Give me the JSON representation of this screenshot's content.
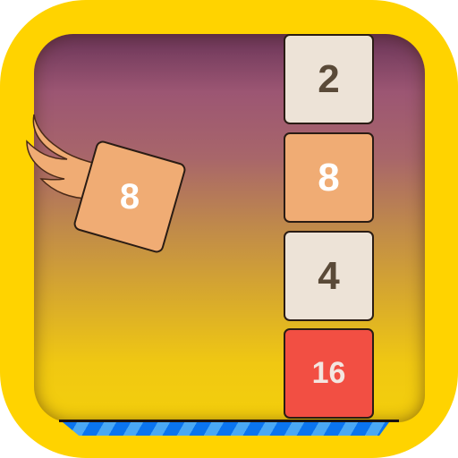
{
  "flying_tile": {
    "value": "8",
    "color": "#f0ac74"
  },
  "stack": [
    {
      "value": "2",
      "color": "#ede3d7"
    },
    {
      "value": "8",
      "color": "#f0ac74"
    },
    {
      "value": "4",
      "color": "#ede3d7"
    },
    {
      "value": "16",
      "color": "#f24f43"
    }
  ],
  "colors": {
    "frame": "#FFD300",
    "floor": "#0a74ef"
  }
}
